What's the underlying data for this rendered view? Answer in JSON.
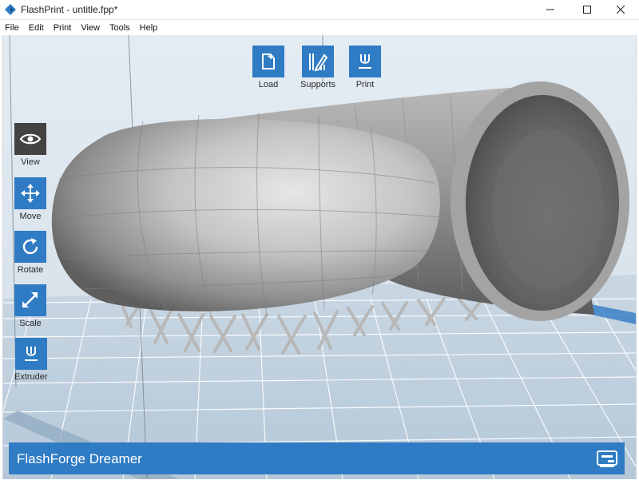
{
  "window": {
    "title": "FlashPrint - untitle.fpp*"
  },
  "menu": [
    "File",
    "Edit",
    "Print",
    "View",
    "Tools",
    "Help"
  ],
  "top_toolbar": [
    {
      "label": "Load",
      "icon": "load-icon"
    },
    {
      "label": "Supports",
      "icon": "supports-icon"
    },
    {
      "label": "Print",
      "icon": "print-icon"
    }
  ],
  "side_toolbar": [
    {
      "label": "View",
      "icon": "eye-icon",
      "active": true
    },
    {
      "label": "Move",
      "icon": "move-icon"
    },
    {
      "label": "Rotate",
      "icon": "rotate-icon"
    },
    {
      "label": "Scale",
      "icon": "scale-icon"
    },
    {
      "label": "Extruder",
      "icon": "extruder-icon"
    }
  ],
  "status": {
    "printer_name": "FlashForge Dreamer",
    "icon": "printer-icon"
  },
  "colors": {
    "accent": "#2f7bc4",
    "active_tool": "#434343",
    "background": "#dfe8f0",
    "model": "#a7a7a7"
  }
}
